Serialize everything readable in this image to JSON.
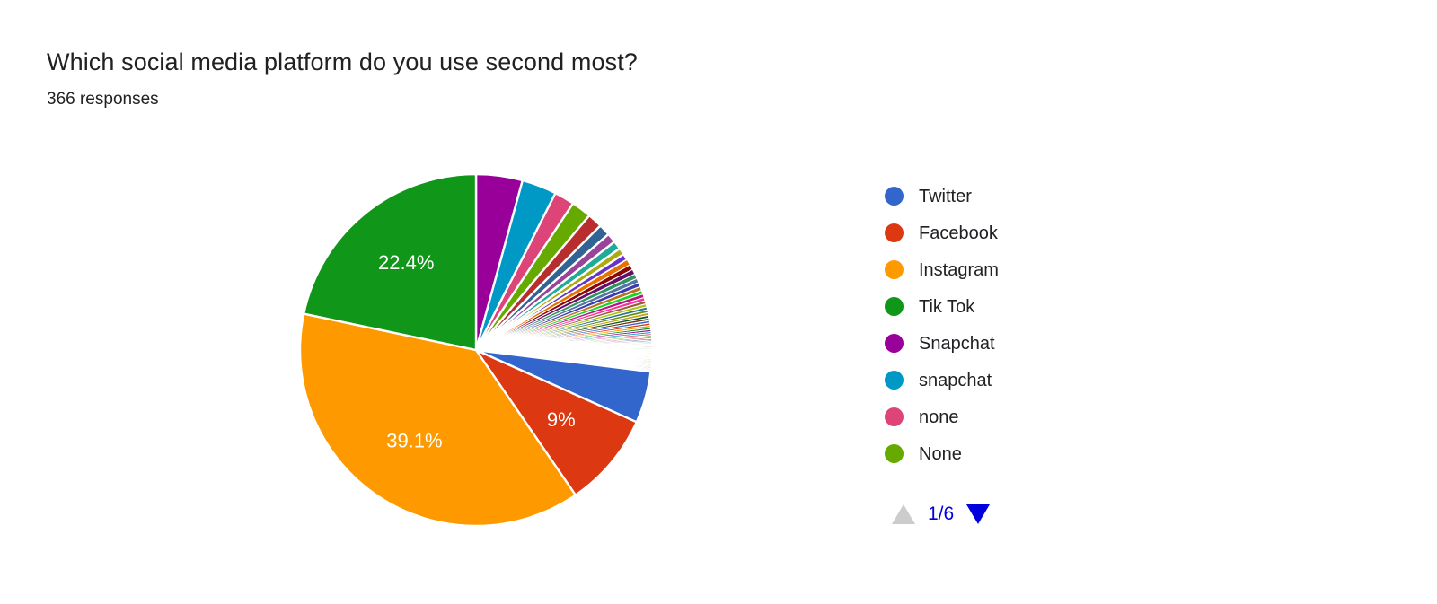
{
  "header": {
    "title": "Which social media platform do you use second most?",
    "subtitle": "366 responses"
  },
  "legend": {
    "items": [
      {
        "label": "Twitter",
        "color": "#3366cc"
      },
      {
        "label": "Facebook",
        "color": "#dc3912"
      },
      {
        "label": "Instagram",
        "color": "#ff9900"
      },
      {
        "label": "Tik Tok",
        "color": "#109618"
      },
      {
        "label": "Snapchat",
        "color": "#990099"
      },
      {
        "label": "snapchat",
        "color": "#0099c6"
      },
      {
        "label": "none",
        "color": "#dd4477"
      },
      {
        "label": "None",
        "color": "#66aa00"
      }
    ]
  },
  "pager": {
    "up_icon": "triangle-up-icon",
    "down_icon": "triangle-down-icon",
    "count": "1/6",
    "up_color": "#cccccc",
    "down_color": "#0000dd",
    "count_color": "#0000dd"
  },
  "chart_data": {
    "type": "pie",
    "title": "Which social media platform do you use second most?",
    "subtitle": "366 responses",
    "total_responses": 366,
    "legend_position": "right",
    "start_angle_deg": 0,
    "direction": "clockwise",
    "slice_label_color": "#ffffff",
    "labels": [
      "Snapchat",
      "snapchat",
      "none",
      "None",
      "Twitter",
      "Facebook",
      "Instagram",
      "Tik Tok"
    ],
    "slices": [
      {
        "label": "Snapchat",
        "percent": 4.4,
        "color": "#990099",
        "data_label": ""
      },
      {
        "label": "snapchat",
        "percent": 3.3,
        "color": "#0099c6",
        "data_label": ""
      },
      {
        "label": "none",
        "percent": 1.9,
        "color": "#dd4477",
        "data_label": ""
      },
      {
        "label": "None",
        "percent": 1.9,
        "color": "#66aa00",
        "data_label": ""
      },
      {
        "label": "",
        "percent": 1.4,
        "color": "#b82e2e",
        "data_label": ""
      },
      {
        "label": "",
        "percent": 1.1,
        "color": "#316395",
        "data_label": ""
      },
      {
        "label": "",
        "percent": 0.9,
        "color": "#994499",
        "data_label": ""
      },
      {
        "label": "",
        "percent": 0.8,
        "color": "#22aa99",
        "data_label": ""
      },
      {
        "label": "",
        "percent": 0.65,
        "color": "#aaaa11",
        "data_label": ""
      },
      {
        "label": "",
        "percent": 0.6,
        "color": "#6633cc",
        "data_label": ""
      },
      {
        "label": "",
        "percent": 0.55,
        "color": "#e67300",
        "data_label": ""
      },
      {
        "label": "",
        "percent": 0.5,
        "color": "#8b0707",
        "data_label": ""
      },
      {
        "label": "",
        "percent": 0.48,
        "color": "#651067",
        "data_label": ""
      },
      {
        "label": "",
        "percent": 0.45,
        "color": "#329262",
        "data_label": ""
      },
      {
        "label": "",
        "percent": 0.42,
        "color": "#5574a6",
        "data_label": ""
      },
      {
        "label": "",
        "percent": 0.4,
        "color": "#3b3eac",
        "data_label": ""
      },
      {
        "label": "",
        "percent": 0.38,
        "color": "#b77322",
        "data_label": ""
      },
      {
        "label": "",
        "percent": 0.36,
        "color": "#16d620",
        "data_label": ""
      },
      {
        "label": "",
        "percent": 0.34,
        "color": "#b91383",
        "data_label": ""
      },
      {
        "label": "",
        "percent": 0.32,
        "color": "#f4359e",
        "data_label": ""
      },
      {
        "label": "",
        "percent": 0.3,
        "color": "#9c5935",
        "data_label": ""
      },
      {
        "label": "",
        "percent": 0.29,
        "color": "#a9c413",
        "data_label": ""
      },
      {
        "label": "",
        "percent": 0.28,
        "color": "#2a778d",
        "data_label": ""
      },
      {
        "label": "",
        "percent": 0.27,
        "color": "#668d1c",
        "data_label": ""
      },
      {
        "label": "",
        "percent": 0.26,
        "color": "#bea413",
        "data_label": ""
      },
      {
        "label": "",
        "percent": 0.25,
        "color": "#0c5922",
        "data_label": ""
      },
      {
        "label": "",
        "percent": 0.24,
        "color": "#743411",
        "data_label": ""
      },
      {
        "label": "",
        "percent": 0.23,
        "color": "#3366cc",
        "data_label": ""
      },
      {
        "label": "",
        "percent": 0.22,
        "color": "#dc3912",
        "data_label": ""
      },
      {
        "label": "",
        "percent": 0.21,
        "color": "#ff9900",
        "data_label": ""
      },
      {
        "label": "",
        "percent": 0.2,
        "color": "#109618",
        "data_label": ""
      },
      {
        "label": "",
        "percent": 0.19,
        "color": "#990099",
        "data_label": ""
      },
      {
        "label": "",
        "percent": 0.18,
        "color": "#0099c6",
        "data_label": ""
      },
      {
        "label": "",
        "percent": 0.17,
        "color": "#dd4477",
        "data_label": ""
      },
      {
        "label": "",
        "percent": 0.16,
        "color": "#66aa00",
        "data_label": ""
      },
      {
        "label": "",
        "percent": 0.15,
        "color": "#b82e2e",
        "data_label": ""
      },
      {
        "label": "",
        "percent": 0.14,
        "color": "#316395",
        "data_label": ""
      },
      {
        "label": "",
        "percent": 0.13,
        "color": "#994499",
        "data_label": ""
      },
      {
        "label": "",
        "percent": 0.12,
        "color": "#22aa99",
        "data_label": ""
      },
      {
        "label": "",
        "percent": 0.11,
        "color": "#aaaa11",
        "data_label": ""
      },
      {
        "label": "",
        "percent": 0.1,
        "color": "#6633cc",
        "data_label": ""
      },
      {
        "label": "",
        "percent": 0.1,
        "color": "#e67300",
        "data_label": ""
      },
      {
        "label": "",
        "percent": 0.1,
        "color": "#8b0707",
        "data_label": ""
      },
      {
        "label": "",
        "percent": 0.1,
        "color": "#651067",
        "data_label": ""
      },
      {
        "label": "",
        "percent": 0.1,
        "color": "#329262",
        "data_label": ""
      },
      {
        "label": "",
        "percent": 0.1,
        "color": "#5574a6",
        "data_label": ""
      },
      {
        "label": "",
        "percent": 0.1,
        "color": "#3b3eac",
        "data_label": ""
      },
      {
        "label": "",
        "percent": 0.1,
        "color": "#b77322",
        "data_label": ""
      },
      {
        "label": "",
        "percent": 0.1,
        "color": "#16d620",
        "data_label": ""
      },
      {
        "label": "",
        "percent": 0.1,
        "color": "#b91383",
        "data_label": ""
      },
      {
        "label": "",
        "percent": 0.1,
        "color": "#f4359e",
        "data_label": ""
      },
      {
        "label": "",
        "percent": 0.1,
        "color": "#9c5935",
        "data_label": ""
      },
      {
        "label": "",
        "percent": 0.1,
        "color": "#a9c413",
        "data_label": ""
      },
      {
        "label": "",
        "percent": 0.1,
        "color": "#2a778d",
        "data_label": ""
      },
      {
        "label": "",
        "percent": 0.1,
        "color": "#668d1c",
        "data_label": ""
      },
      {
        "label": "",
        "percent": 0.1,
        "color": "#bea413",
        "data_label": ""
      },
      {
        "label": "",
        "percent": 0.1,
        "color": "#0c5922",
        "data_label": ""
      },
      {
        "label": "",
        "percent": 0.1,
        "color": "#743411",
        "data_label": ""
      },
      {
        "label": "",
        "percent": 0.1,
        "color": "#3366cc",
        "data_label": ""
      },
      {
        "label": "",
        "percent": 0.1,
        "color": "#dc3912",
        "data_label": ""
      },
      {
        "label": "",
        "percent": 0.1,
        "color": "#ff9900",
        "data_label": ""
      },
      {
        "label": "",
        "percent": 0.1,
        "color": "#109618",
        "data_label": ""
      },
      {
        "label": "",
        "percent": 0.1,
        "color": "#990099",
        "data_label": ""
      },
      {
        "label": "",
        "percent": 0.1,
        "color": "#0099c6",
        "data_label": ""
      },
      {
        "label": "",
        "percent": 0.1,
        "color": "#dd4477",
        "data_label": ""
      },
      {
        "label": "",
        "percent": 0.1,
        "color": "#66aa00",
        "data_label": ""
      },
      {
        "label": "Twitter",
        "percent": 4.9,
        "color": "#3366cc",
        "data_label": ""
      },
      {
        "label": "Facebook",
        "percent": 9.0,
        "color": "#dc3912",
        "data_label": "9%"
      },
      {
        "label": "Instagram",
        "percent": 39.1,
        "color": "#ff9900",
        "data_label": "39.1%"
      },
      {
        "label": "Tik Tok",
        "percent": 22.4,
        "color": "#109618",
        "data_label": "22.4%"
      }
    ]
  }
}
